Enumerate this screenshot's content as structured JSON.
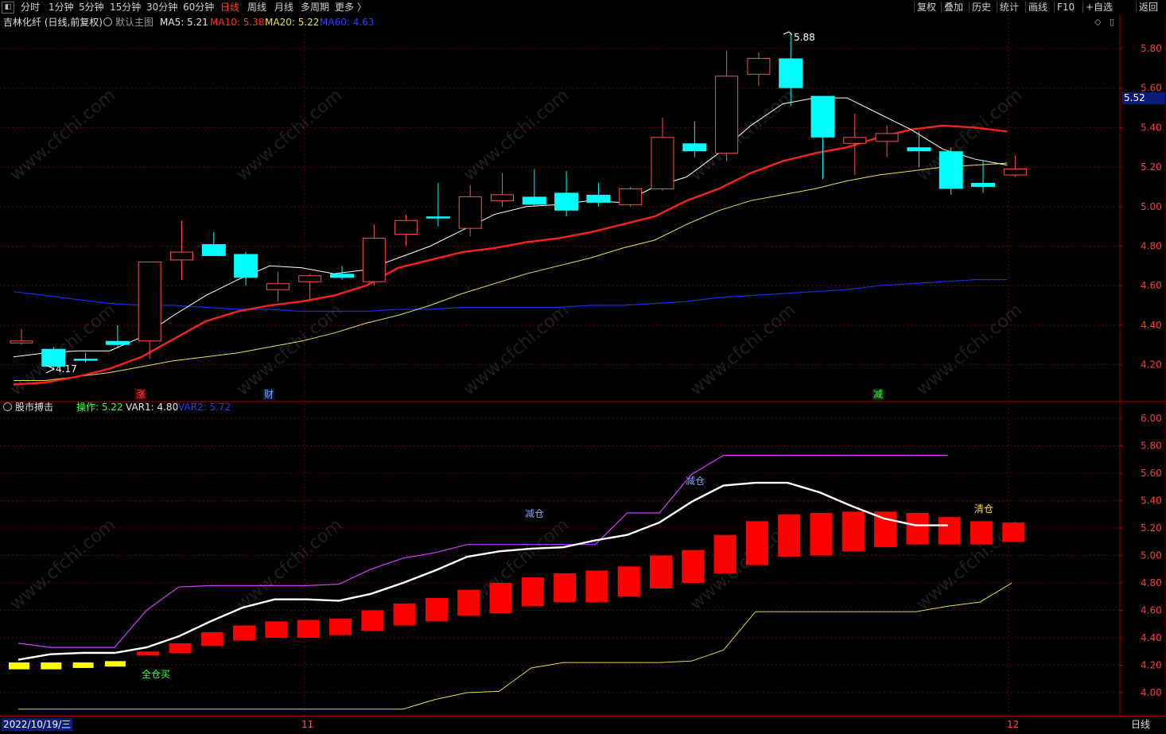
{
  "toolbar": {
    "periods": [
      "分时",
      "1分钟",
      "5分钟",
      "15分钟",
      "30分钟",
      "60分钟",
      "日线",
      "周线",
      "月线",
      "多周期",
      "更多 〉"
    ],
    "active_period": "日线",
    "right_items": [
      "复权",
      "叠加",
      "历史",
      "统计",
      "画线",
      "F10",
      "+自选",
      "返回"
    ],
    "side_toggle_icon": "panel-toggle-icon"
  },
  "main_header": {
    "title": "吉林化纤 (日线,前复权)",
    "template": "默认主图",
    "ma5": "MA5: 5.21",
    "ma10": "MA10: 5.38",
    "ma20": "MA20: 5.22",
    "ma60": "MA60: 4.63"
  },
  "main_price_tag": "5.52",
  "main_high_label": "5.88",
  "main_low_label": "4.17",
  "main_yaxis": [
    "5.80",
    "5.60",
    "5.40",
    "5.20",
    "5.00",
    "4.80",
    "4.60",
    "4.40",
    "4.20"
  ],
  "markers": [
    {
      "text": "涨",
      "color": "#ff4040"
    },
    {
      "text": "财",
      "color": "#7fa8ff"
    },
    {
      "text": "减",
      "color": "#40ff40"
    }
  ],
  "ind_header": {
    "name": "股市搏击",
    "op": "操作: 5.22",
    "var1": "VAR1: 4.80",
    "var2": "VAR2: 5.72"
  },
  "ind_yaxis": [
    "6.00",
    "5.80",
    "5.60",
    "5.40",
    "5.20",
    "5.00",
    "4.80",
    "4.60",
    "4.40",
    "4.20",
    "4.00"
  ],
  "ind_annotations": {
    "buy": "全仓买",
    "reduce1": "减仓",
    "reduce2": "减仓",
    "clear": "清仓"
  },
  "statusbar": {
    "date": "2022/10/19/三",
    "month11": "11",
    "month12": "12",
    "period": "日线"
  },
  "colors": {
    "up": "#ff5050",
    "down": "#00ffff",
    "ma5": "#ffffff",
    "ma10": "#ff2020",
    "ma20": "#e6e64c",
    "ma60": "#1a2ee6",
    "grid": "#700000",
    "axis_text": "#ff3c3c"
  },
  "chart_data": {
    "type": "candlestick",
    "candles": [
      {
        "o": 4.31,
        "h": 4.38,
        "l": 4.3,
        "c": 4.32
      },
      {
        "o": 4.28,
        "h": 4.29,
        "l": 4.17,
        "c": 4.19
      },
      {
        "o": 4.23,
        "h": 4.26,
        "l": 4.21,
        "c": 4.22
      },
      {
        "o": 4.32,
        "h": 4.4,
        "l": 4.29,
        "c": 4.3
      },
      {
        "o": 4.32,
        "h": 4.72,
        "l": 4.23,
        "c": 4.72
      },
      {
        "o": 4.73,
        "h": 4.93,
        "l": 4.63,
        "c": 4.77
      },
      {
        "o": 4.81,
        "h": 4.87,
        "l": 4.75,
        "c": 4.75
      },
      {
        "o": 4.76,
        "h": 4.77,
        "l": 4.6,
        "c": 4.64
      },
      {
        "o": 4.58,
        "h": 4.67,
        "l": 4.52,
        "c": 4.61
      },
      {
        "o": 4.62,
        "h": 4.66,
        "l": 4.53,
        "c": 4.65
      },
      {
        "o": 4.66,
        "h": 4.7,
        "l": 4.63,
        "c": 4.64
      },
      {
        "o": 4.62,
        "h": 4.91,
        "l": 4.6,
        "c": 4.84
      },
      {
        "o": 4.86,
        "h": 4.96,
        "l": 4.8,
        "c": 4.93
      },
      {
        "o": 4.95,
        "h": 5.12,
        "l": 4.9,
        "c": 4.94
      },
      {
        "o": 4.89,
        "h": 5.11,
        "l": 4.85,
        "c": 5.05
      },
      {
        "o": 5.03,
        "h": 5.17,
        "l": 5.0,
        "c": 5.06
      },
      {
        "o": 5.05,
        "h": 5.19,
        "l": 5.0,
        "c": 5.01
      },
      {
        "o": 5.07,
        "h": 5.18,
        "l": 4.95,
        "c": 4.98
      },
      {
        "o": 5.06,
        "h": 5.12,
        "l": 5.0,
        "c": 5.02
      },
      {
        "o": 5.01,
        "h": 5.1,
        "l": 5.0,
        "c": 5.09
      },
      {
        "o": 5.09,
        "h": 5.45,
        "l": 5.08,
        "c": 5.35
      },
      {
        "o": 5.32,
        "h": 5.43,
        "l": 5.25,
        "c": 5.28
      },
      {
        "o": 5.27,
        "h": 5.79,
        "l": 5.23,
        "c": 5.66
      },
      {
        "o": 5.67,
        "h": 5.78,
        "l": 5.61,
        "c": 5.75
      },
      {
        "o": 5.75,
        "h": 5.88,
        "l": 5.51,
        "c": 5.6
      },
      {
        "o": 5.56,
        "h": 5.56,
        "l": 5.14,
        "c": 5.35
      },
      {
        "o": 5.32,
        "h": 5.47,
        "l": 5.16,
        "c": 5.35
      },
      {
        "o": 5.33,
        "h": 5.41,
        "l": 5.25,
        "c": 5.37
      },
      {
        "o": 5.3,
        "h": 5.38,
        "l": 5.2,
        "c": 5.28
      },
      {
        "o": 5.28,
        "h": 5.3,
        "l": 5.06,
        "c": 5.09
      },
      {
        "o": 5.12,
        "h": 5.23,
        "l": 5.07,
        "c": 5.1
      },
      {
        "o": 5.16,
        "h": 5.26,
        "l": 5.15,
        "c": 5.19
      }
    ],
    "ma5": [
      4.24,
      4.26,
      4.27,
      4.27,
      4.34,
      4.45,
      4.55,
      4.63,
      4.7,
      4.69,
      4.66,
      4.68,
      4.74,
      4.8,
      4.88,
      4.96,
      5.0,
      5.01,
      5.03,
      5.02,
      5.1,
      5.15,
      5.27,
      5.41,
      5.52,
      5.55,
      5.55,
      5.47,
      5.39,
      5.29,
      5.24,
      5.21
    ],
    "ma10": [
      4.1,
      4.11,
      4.14,
      4.18,
      4.24,
      4.33,
      4.42,
      4.47,
      4.5,
      4.52,
      4.55,
      4.6,
      4.69,
      4.73,
      4.77,
      4.79,
      4.82,
      4.84,
      4.87,
      4.91,
      4.95,
      5.03,
      5.09,
      5.17,
      5.23,
      5.27,
      5.3,
      5.35,
      5.39,
      5.41,
      5.4,
      5.38
    ],
    "ma20": [
      4.12,
      4.12,
      4.14,
      4.16,
      4.19,
      4.22,
      4.24,
      4.26,
      4.29,
      4.32,
      4.36,
      4.41,
      4.45,
      4.5,
      4.56,
      4.61,
      4.66,
      4.7,
      4.74,
      4.79,
      4.83,
      4.91,
      4.98,
      5.03,
      5.06,
      5.09,
      5.13,
      5.16,
      5.18,
      5.2,
      5.21,
      5.22
    ],
    "ma60": [
      4.57,
      4.55,
      4.53,
      4.51,
      4.5,
      4.5,
      4.49,
      4.48,
      4.48,
      4.47,
      4.47,
      4.47,
      4.48,
      4.48,
      4.49,
      4.49,
      4.49,
      4.49,
      4.5,
      4.5,
      4.51,
      4.52,
      4.54,
      4.55,
      4.56,
      4.57,
      4.58,
      4.6,
      4.61,
      4.62,
      4.63,
      4.63
    ],
    "ind_white": [
      4.24,
      4.28,
      4.29,
      4.29,
      4.33,
      4.41,
      4.52,
      4.62,
      4.68,
      4.68,
      4.67,
      4.72,
      4.8,
      4.89,
      4.99,
      5.03,
      5.05,
      5.06,
      5.11,
      5.15,
      5.24,
      5.39,
      5.51,
      5.53,
      5.53,
      5.46,
      5.36,
      5.27,
      5.22,
      5.22
    ],
    "ind_magenta": [
      4.36,
      4.33,
      4.33,
      4.33,
      4.6,
      4.77,
      4.78,
      4.78,
      4.78,
      4.78,
      4.79,
      4.9,
      4.98,
      5.02,
      5.08,
      5.08,
      5.08,
      5.08,
      5.08,
      5.31,
      5.31,
      5.59,
      5.73,
      5.73,
      5.73,
      5.73,
      5.73,
      5.73,
      5.73,
      5.73
    ],
    "ind_yellow": [
      3.88,
      3.88,
      3.88,
      3.88,
      3.88,
      3.88,
      3.88,
      3.88,
      3.88,
      3.88,
      3.88,
      3.88,
      3.88,
      3.95,
      4.0,
      4.01,
      4.18,
      4.22,
      4.22,
      4.22,
      4.22,
      4.23,
      4.31,
      4.59,
      4.59,
      4.59,
      4.59,
      4.59,
      4.59,
      4.63,
      4.66,
      4.8
    ],
    "ind_bars": [
      {
        "t": 4.22,
        "b": 4.17,
        "c": "y"
      },
      {
        "t": 4.22,
        "b": 4.17,
        "c": "y"
      },
      {
        "t": 4.22,
        "b": 4.18,
        "c": "y"
      },
      {
        "t": 4.23,
        "b": 4.19,
        "c": "y"
      },
      {
        "t": 4.3,
        "b": 4.27,
        "c": "r"
      },
      {
        "t": 4.36,
        "b": 4.29,
        "c": "r"
      },
      {
        "t": 4.44,
        "b": 4.34,
        "c": "r"
      },
      {
        "t": 4.49,
        "b": 4.38,
        "c": "r"
      },
      {
        "t": 4.52,
        "b": 4.4,
        "c": "r"
      },
      {
        "t": 4.53,
        "b": 4.4,
        "c": "r"
      },
      {
        "t": 4.54,
        "b": 4.42,
        "c": "r"
      },
      {
        "t": 4.6,
        "b": 4.45,
        "c": "r"
      },
      {
        "t": 4.65,
        "b": 4.49,
        "c": "r"
      },
      {
        "t": 4.69,
        "b": 4.52,
        "c": "r"
      },
      {
        "t": 4.75,
        "b": 4.56,
        "c": "r"
      },
      {
        "t": 4.8,
        "b": 4.58,
        "c": "r"
      },
      {
        "t": 4.84,
        "b": 4.63,
        "c": "r"
      },
      {
        "t": 4.87,
        "b": 4.66,
        "c": "r"
      },
      {
        "t": 4.89,
        "b": 4.66,
        "c": "r"
      },
      {
        "t": 4.92,
        "b": 4.7,
        "c": "r"
      },
      {
        "t": 5.0,
        "b": 4.76,
        "c": "r"
      },
      {
        "t": 5.04,
        "b": 4.8,
        "c": "r"
      },
      {
        "t": 5.15,
        "b": 4.87,
        "c": "r"
      },
      {
        "t": 5.25,
        "b": 4.93,
        "c": "r"
      },
      {
        "t": 5.3,
        "b": 4.99,
        "c": "r"
      },
      {
        "t": 5.31,
        "b": 5.0,
        "c": "r"
      },
      {
        "t": 5.32,
        "b": 5.03,
        "c": "r"
      },
      {
        "t": 5.32,
        "b": 5.06,
        "c": "r"
      },
      {
        "t": 5.31,
        "b": 5.08,
        "c": "r"
      },
      {
        "t": 5.28,
        "b": 5.08,
        "c": "r"
      },
      {
        "t": 5.25,
        "b": 5.08,
        "c": "r"
      },
      {
        "t": 5.24,
        "b": 5.1,
        "c": "r"
      }
    ]
  }
}
